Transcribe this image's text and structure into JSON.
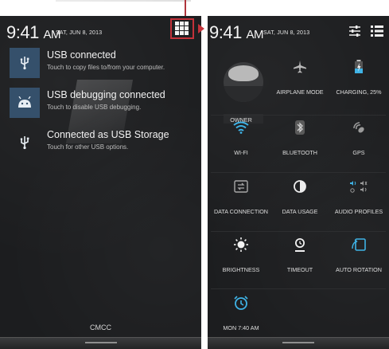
{
  "left": {
    "time": "9:41",
    "ampm": "AM",
    "date": "SAT, JUN 8, 2013",
    "notifications": [
      {
        "title": "USB connected",
        "subtitle": "Touch to copy files to/from your computer.",
        "icon": "usb-icon"
      },
      {
        "title": "USB debugging connected",
        "subtitle": "Touch to disable USB debugging.",
        "icon": "android-debug-icon"
      },
      {
        "title": "Connected as USB Storage",
        "subtitle": "Touch for other USB options.",
        "icon": "usb-icon"
      }
    ],
    "carrier": "CMCC",
    "highlight_color": "#c3323a"
  },
  "right": {
    "time": "9:41",
    "ampm": "AM",
    "date": "SAT, JUN 8, 2013",
    "tiles": [
      {
        "label": "OWNER",
        "icon": "owner-avatar"
      },
      {
        "label": "AIRPLANE MODE",
        "icon": "airplane-icon"
      },
      {
        "label": "CHARGING, 25%",
        "icon": "battery-charging-icon"
      },
      {
        "label": "WI-FI",
        "icon": "wifi-icon"
      },
      {
        "label": "BLUETOOTH",
        "icon": "bluetooth-icon"
      },
      {
        "label": "GPS",
        "icon": "gps-icon"
      },
      {
        "label": "DATA CONNECTION",
        "icon": "data-connection-icon"
      },
      {
        "label": "DATA USAGE",
        "icon": "data-usage-icon"
      },
      {
        "label": "AUDIO PROFILES",
        "icon": "audio-profiles-icon"
      },
      {
        "label": "BRIGHTNESS",
        "icon": "brightness-icon"
      },
      {
        "label": "TIMEOUT",
        "icon": "timeout-icon"
      },
      {
        "label": "AUTO ROTATION",
        "icon": "auto-rotation-icon"
      },
      {
        "label": "MON 7:40 AM",
        "icon": "alarm-clock-icon"
      }
    ],
    "accent": "#3fb3e6"
  }
}
